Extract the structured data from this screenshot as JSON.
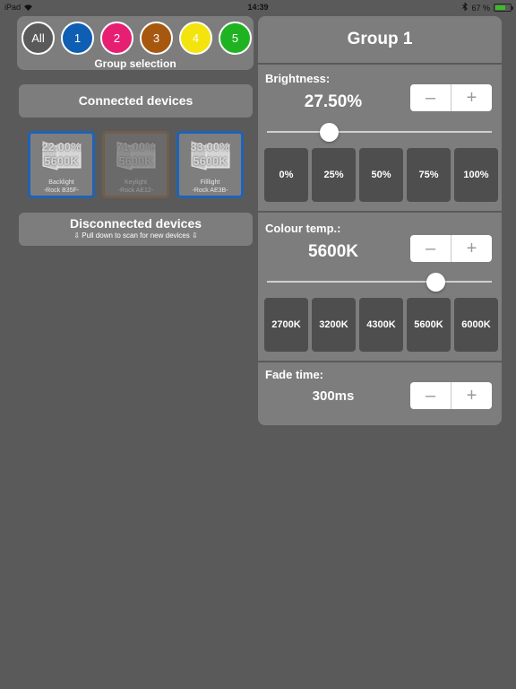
{
  "status_bar": {
    "device": "iPad",
    "time": "14:39",
    "battery_percent": "67 %",
    "battery_level": 0.67
  },
  "groups": {
    "label": "Group selection",
    "items": [
      {
        "label": "All",
        "color": "#5a5a5a"
      },
      {
        "label": "1",
        "color": "#0e5eb3"
      },
      {
        "label": "2",
        "color": "#e61f72"
      },
      {
        "label": "3",
        "color": "#a6580f"
      },
      {
        "label": "4",
        "color": "#f3e40e"
      },
      {
        "label": "5",
        "color": "#1fb321"
      }
    ]
  },
  "connected_label": "Connected devices",
  "devices": [
    {
      "brightness": "22.00%",
      "temp": "5600K",
      "name": "Backlight",
      "id": "-Rock B35F-",
      "active": true
    },
    {
      "brightness": "71.00%",
      "temp": "5600K",
      "name": "Keylight",
      "id": "-Rock AE12-",
      "active": false
    },
    {
      "brightness": "33.00%",
      "temp": "5600K",
      "name": "Filllight",
      "id": "-Rock AE3B-",
      "active": true
    }
  ],
  "disconnected": {
    "title": "Disconnected devices",
    "hint": "⇩ Pull down to scan for new devices ⇩"
  },
  "group_title": "Group 1",
  "brightness": {
    "label": "Brightness:",
    "value": "27.50%",
    "slider_level": 0.275,
    "presets": [
      "0%",
      "25%",
      "50%",
      "75%",
      "100%"
    ]
  },
  "colour_temp": {
    "label": "Colour temp.:",
    "value": "5600K",
    "slider_level": 0.75,
    "presets": [
      "2700K",
      "3200K",
      "4300K",
      "5600K",
      "6000K"
    ]
  },
  "fade": {
    "label": "Fade time:",
    "value": "300ms"
  },
  "stepper": {
    "minus": "–",
    "plus": "+"
  }
}
